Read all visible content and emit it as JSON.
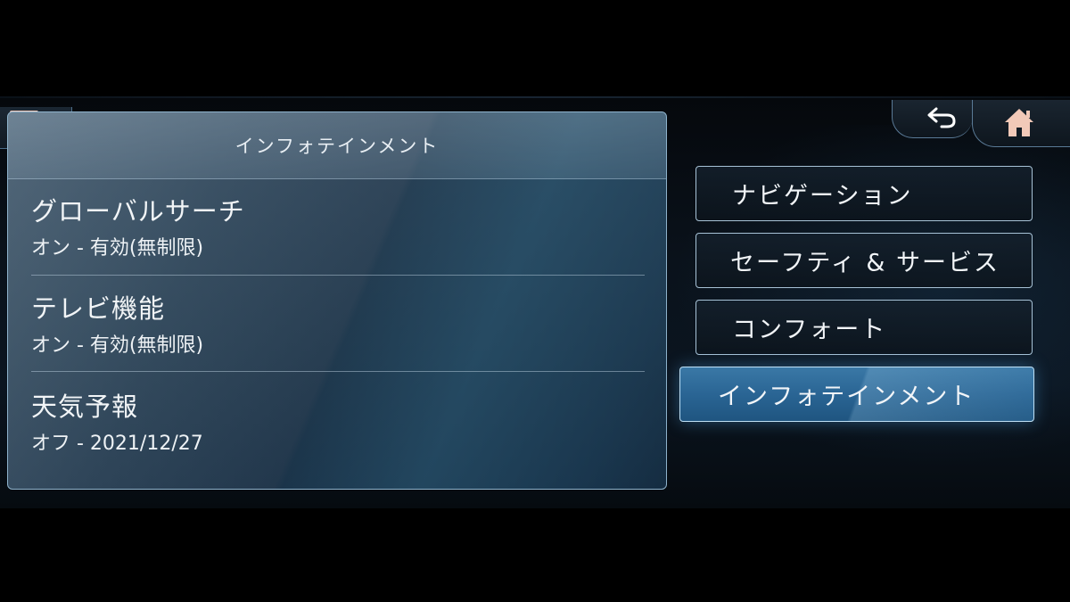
{
  "panel": {
    "title": "インフォテインメント",
    "items": [
      {
        "label": "グローバルサーチ",
        "value": "オン - 有効(無制限)"
      },
      {
        "label": "テレビ機能",
        "value": "オン - 有効(無制限)"
      },
      {
        "label": "天気予報",
        "value": "オフ - 2021/12/27"
      }
    ]
  },
  "menu": {
    "items": [
      {
        "label": "ナビゲーション"
      },
      {
        "label": "セーフティ & サービス"
      },
      {
        "label": "コンフォート"
      },
      {
        "label": "インフォテインメント",
        "selected": true
      }
    ]
  },
  "icons": {
    "message": "message-icon",
    "back": "back-arrow-icon",
    "home": "home-icon"
  },
  "colors": {
    "accent_selected": "#2a6594",
    "message_icon": "#f2c9b8",
    "border": "#a7c2d6"
  }
}
